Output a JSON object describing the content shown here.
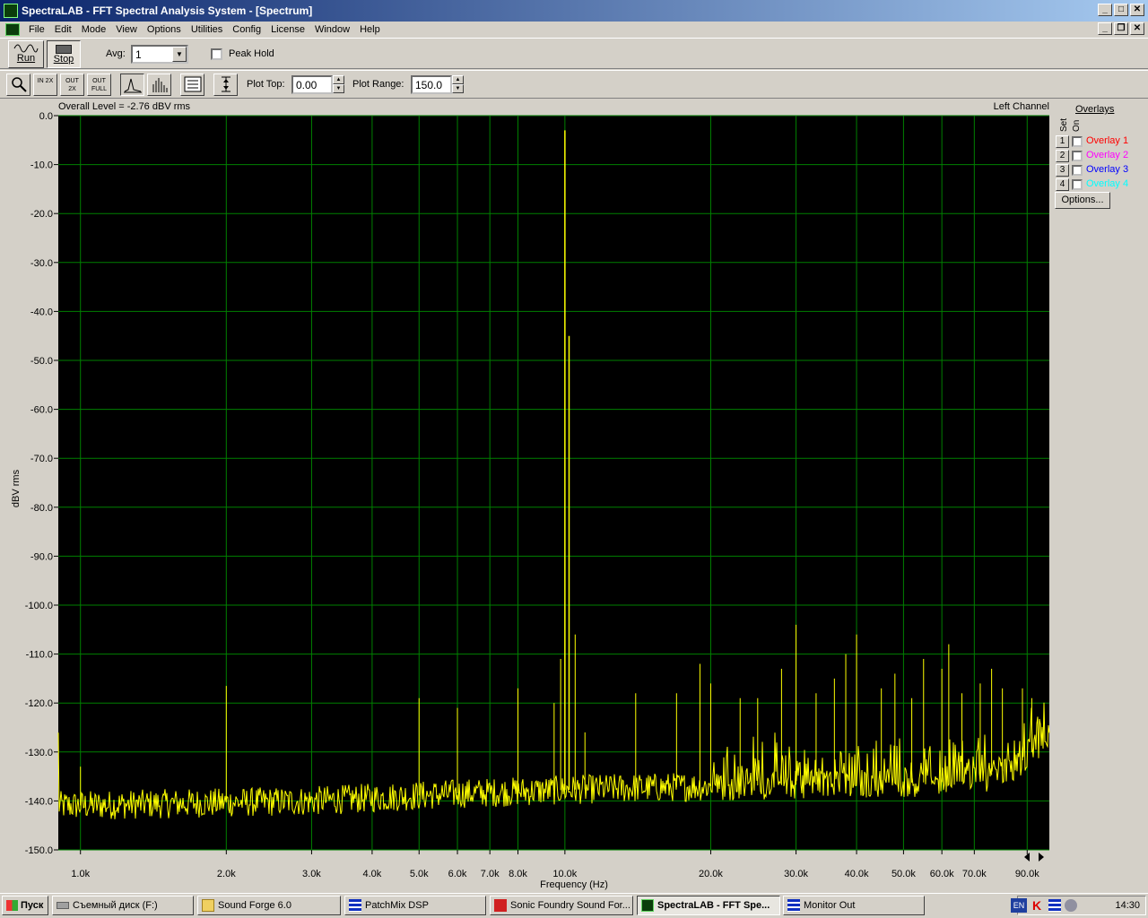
{
  "window": {
    "title": "SpectraLAB - FFT Spectral Analysis System - [Spectrum]",
    "min_glyph": "_",
    "max_glyph": "□",
    "close_glyph": "✕",
    "restore_glyph": "❐"
  },
  "menu": [
    "File",
    "Edit",
    "Mode",
    "View",
    "Options",
    "Utilities",
    "Config",
    "License",
    "Window",
    "Help"
  ],
  "toolbar": {
    "run_label": "Run",
    "stop_label": "Stop",
    "avg_label": "Avg:",
    "avg_value": "1",
    "peak_hold_label": "Peak Hold",
    "plot_top_label": "Plot Top:",
    "plot_top_value": "0.00",
    "plot_range_label": "Plot Range:",
    "plot_range_value": "150.0",
    "zoom_in_text": "IN 2X",
    "zoom_out_text": "OUT 2X",
    "zoom_full_text": "OUT FULL"
  },
  "overlays": {
    "title": "Overlays",
    "set_label": "Set",
    "on_label": "On",
    "items": [
      {
        "num": "1",
        "label": "Overlay 1",
        "color": "#ff0000"
      },
      {
        "num": "2",
        "label": "Overlay 2",
        "color": "#ff00ff"
      },
      {
        "num": "3",
        "label": "Overlay 3",
        "color": "#0000ff"
      },
      {
        "num": "4",
        "label": "Overlay 4",
        "color": "#00ffff"
      }
    ],
    "options_label": "Options..."
  },
  "chart_data": {
    "type": "line",
    "title": "Overall Level = -2.76 dBV rms",
    "channel": "Left Channel",
    "xlabel": "Frequency (Hz)",
    "ylabel": "dBV rms",
    "x_scale": "log",
    "xlim": [
      900,
      100000
    ],
    "ylim": [
      -150,
      0
    ],
    "grid": true,
    "background": "#000000",
    "grid_color": "#008000",
    "trace_color": "#ffff00",
    "x_ticks": [
      {
        "value": 1000,
        "label": "1.0k"
      },
      {
        "value": 2000,
        "label": "2.0k"
      },
      {
        "value": 3000,
        "label": "3.0k"
      },
      {
        "value": 4000,
        "label": "4.0k"
      },
      {
        "value": 5000,
        "label": "5.0k"
      },
      {
        "value": 6000,
        "label": "6.0k"
      },
      {
        "value": 7000,
        "label": "7.0k"
      },
      {
        "value": 8000,
        "label": "8.0k"
      },
      {
        "value": 10000,
        "label": "10.0k"
      },
      {
        "value": 20000,
        "label": "20.0k"
      },
      {
        "value": 30000,
        "label": "30.0k"
      },
      {
        "value": 40000,
        "label": "40.0k"
      },
      {
        "value": 50000,
        "label": "50.0k"
      },
      {
        "value": 60000,
        "label": "60.0k"
      },
      {
        "value": 70000,
        "label": "70.0k"
      },
      {
        "value": 90000,
        "label": "90.0k"
      }
    ],
    "y_ticks": [
      "0.0",
      "-10.0",
      "-20.0",
      "-30.0",
      "-40.0",
      "-50.0",
      "-60.0",
      "-70.0",
      "-80.0",
      "-90.0",
      "-100.0",
      "-110.0",
      "-120.0",
      "-130.0",
      "-140.0",
      "-150.0"
    ],
    "noise_floor": [
      {
        "f": 900,
        "db": -141
      },
      {
        "f": 3000,
        "db": -140
      },
      {
        "f": 6000,
        "db": -138.5
      },
      {
        "f": 12000,
        "db": -137.5
      },
      {
        "f": 20000,
        "db": -137
      },
      {
        "f": 40000,
        "db": -136.5
      },
      {
        "f": 70000,
        "db": -136
      },
      {
        "f": 85000,
        "db": -133
      },
      {
        "f": 100000,
        "db": -127
      }
    ],
    "peaks": [
      {
        "f": 1000,
        "db": -133
      },
      {
        "f": 2000,
        "db": -116.5
      },
      {
        "f": 5000,
        "db": -119
      },
      {
        "f": 6000,
        "db": -121
      },
      {
        "f": 8000,
        "db": -117
      },
      {
        "f": 9500,
        "db": -120
      },
      {
        "f": 9800,
        "db": -111
      },
      {
        "f": 10000,
        "db": -3
      },
      {
        "f": 10200,
        "db": -45
      },
      {
        "f": 10500,
        "db": -106
      },
      {
        "f": 11000,
        "db": -126
      },
      {
        "f": 14000,
        "db": -118
      },
      {
        "f": 17000,
        "db": -118
      },
      {
        "f": 19000,
        "db": -112
      },
      {
        "f": 20000,
        "db": -116
      },
      {
        "f": 23000,
        "db": -119
      },
      {
        "f": 25000,
        "db": -119
      },
      {
        "f": 28000,
        "db": -113
      },
      {
        "f": 30000,
        "db": -104
      },
      {
        "f": 33000,
        "db": -118
      },
      {
        "f": 36000,
        "db": -115
      },
      {
        "f": 38000,
        "db": -110
      },
      {
        "f": 40000,
        "db": -106
      },
      {
        "f": 45000,
        "db": -117
      },
      {
        "f": 48000,
        "db": -114
      },
      {
        "f": 52000,
        "db": -119
      },
      {
        "f": 55000,
        "db": -111
      },
      {
        "f": 60000,
        "db": -113
      },
      {
        "f": 62000,
        "db": -108
      },
      {
        "f": 66000,
        "db": -118
      },
      {
        "f": 72000,
        "db": -116
      },
      {
        "f": 76000,
        "db": -113
      },
      {
        "f": 80000,
        "db": -117
      },
      {
        "f": 88000,
        "db": -117
      },
      {
        "f": 92000,
        "db": -119
      }
    ]
  },
  "taskbar": {
    "start_label": "Пуск",
    "tasks": [
      {
        "label": "Съемный диск (F:)",
        "icon": "drive-icon"
      },
      {
        "label": "Sound Forge 6.0",
        "icon": "folder-icon"
      },
      {
        "label": "PatchMix DSP",
        "icon": "mixer-icon"
      },
      {
        "label": "Sonic Foundry Sound For...",
        "icon": "soundforge-icon"
      },
      {
        "label": "SpectraLAB - FFT Spe...",
        "icon": "spectralab-icon"
      },
      {
        "label": "Monitor Out",
        "icon": "mixer-icon"
      }
    ],
    "lang": "EN",
    "time": "14:30"
  }
}
